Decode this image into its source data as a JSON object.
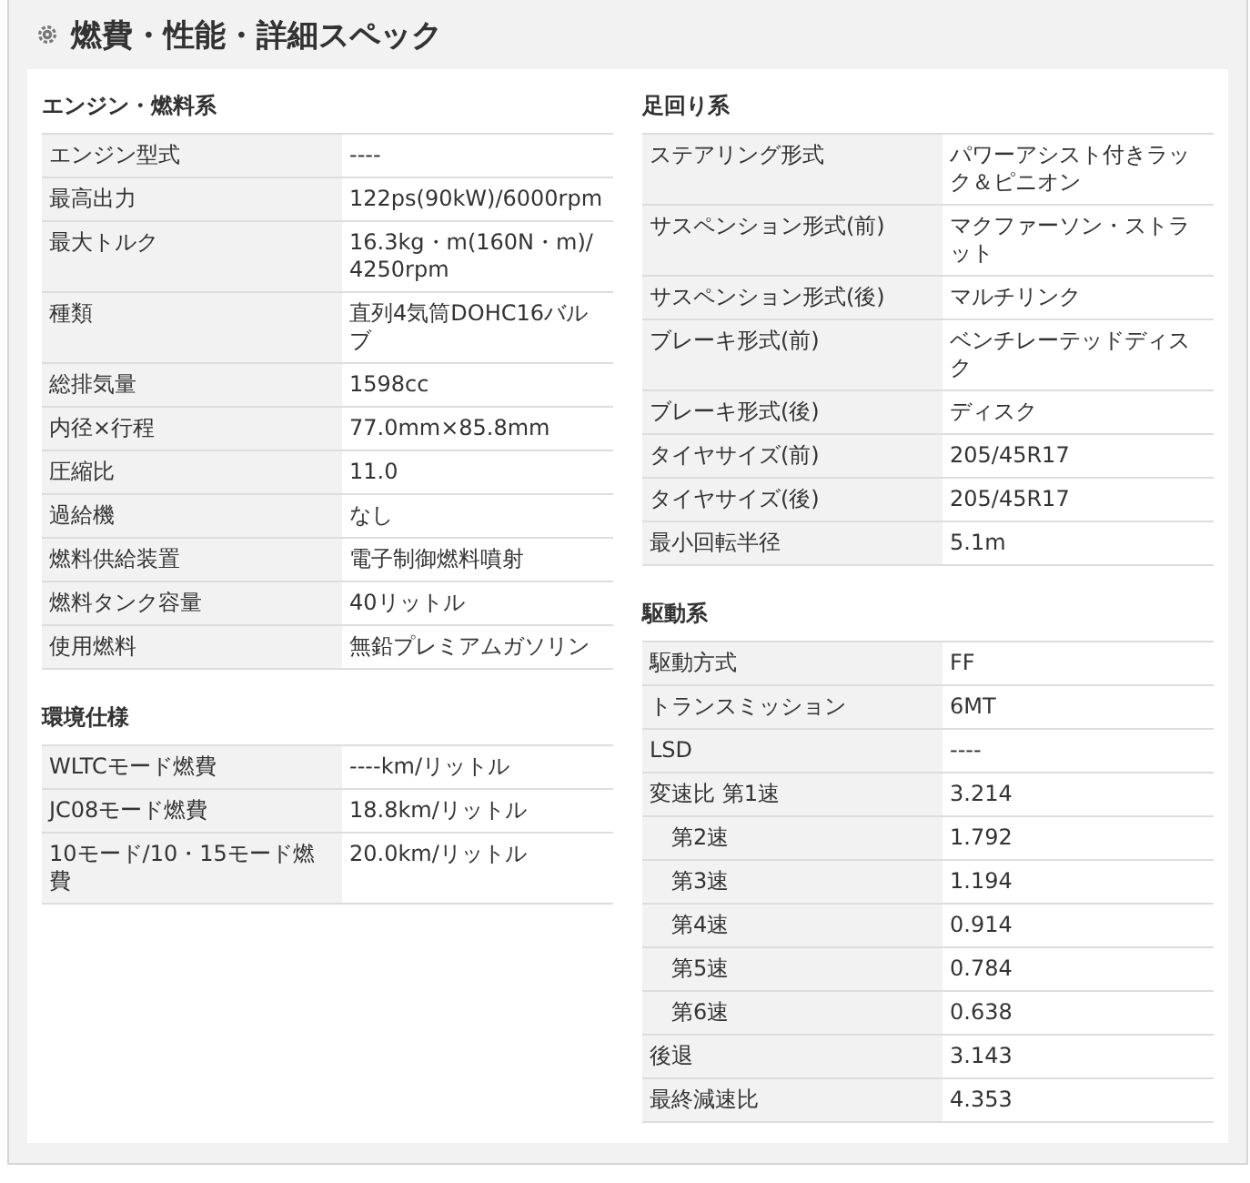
{
  "title": "燃費・性能・詳細スペック",
  "columns": [
    [
      {
        "heading": "エンジン・燃料系",
        "rows": [
          {
            "label": "エンジン型式",
            "value": "----"
          },
          {
            "label": "最高出力",
            "value": "122ps(90kW)/6000rpm"
          },
          {
            "label": "最大トルク",
            "value": "16.3kg・m(160N・m)/4250rpm"
          },
          {
            "label": "種類",
            "value": "直列4気筒DOHC16バルブ"
          },
          {
            "label": "総排気量",
            "value": "1598cc"
          },
          {
            "label": "内径×行程",
            "value": "77.0mm×85.8mm"
          },
          {
            "label": "圧縮比",
            "value": "11.0"
          },
          {
            "label": "過給機",
            "value": "なし"
          },
          {
            "label": "燃料供給装置",
            "value": "電子制御燃料噴射"
          },
          {
            "label": "燃料タンク容量",
            "value": "40リットル"
          },
          {
            "label": "使用燃料",
            "value": "無鉛プレミアムガソリン"
          }
        ]
      },
      {
        "heading": "環境仕様",
        "rows": [
          {
            "label": "WLTCモード燃費",
            "value": "----km/リットル"
          },
          {
            "label": "JC08モード燃費",
            "value": "18.8km/リットル"
          },
          {
            "label": "10モード/10・15モード燃費",
            "value": "20.0km/リットル"
          }
        ]
      }
    ],
    [
      {
        "heading": "足回り系",
        "rows": [
          {
            "label": "ステアリング形式",
            "value": "パワーアシスト付きラック＆ピニオン"
          },
          {
            "label": "サスペンション形式(前)",
            "value": "マクファーソン・ストラット"
          },
          {
            "label": "サスペンション形式(後)",
            "value": "マルチリンク"
          },
          {
            "label": "ブレーキ形式(前)",
            "value": "ベンチレーテッドディスク"
          },
          {
            "label": "ブレーキ形式(後)",
            "value": "ディスク"
          },
          {
            "label": "タイヤサイズ(前)",
            "value": "205/45R17"
          },
          {
            "label": "タイヤサイズ(後)",
            "value": "205/45R17"
          },
          {
            "label": "最小回転半径",
            "value": "5.1m"
          }
        ]
      },
      {
        "heading": "駆動系",
        "rows": [
          {
            "label": "駆動方式",
            "value": "FF",
            "kind": "main"
          },
          {
            "label": "トランスミッション",
            "value": "6MT",
            "kind": "main"
          },
          {
            "label": "LSD",
            "value": "----",
            "kind": "main"
          },
          {
            "label": "変速比 第1速",
            "value": "3.214",
            "kind": "main"
          },
          {
            "label": "第2速",
            "value": "1.792",
            "kind": "sub"
          },
          {
            "label": "第3速",
            "value": "1.194",
            "kind": "sub"
          },
          {
            "label": "第4速",
            "value": "0.914",
            "kind": "sub"
          },
          {
            "label": "第5速",
            "value": "0.784",
            "kind": "sub"
          },
          {
            "label": "第6速",
            "value": "0.638",
            "kind": "sub"
          },
          {
            "label": "後退",
            "value": "3.143",
            "kind": "main"
          },
          {
            "label": "最終減速比",
            "value": "4.353",
            "kind": "main"
          }
        ]
      }
    ]
  ]
}
